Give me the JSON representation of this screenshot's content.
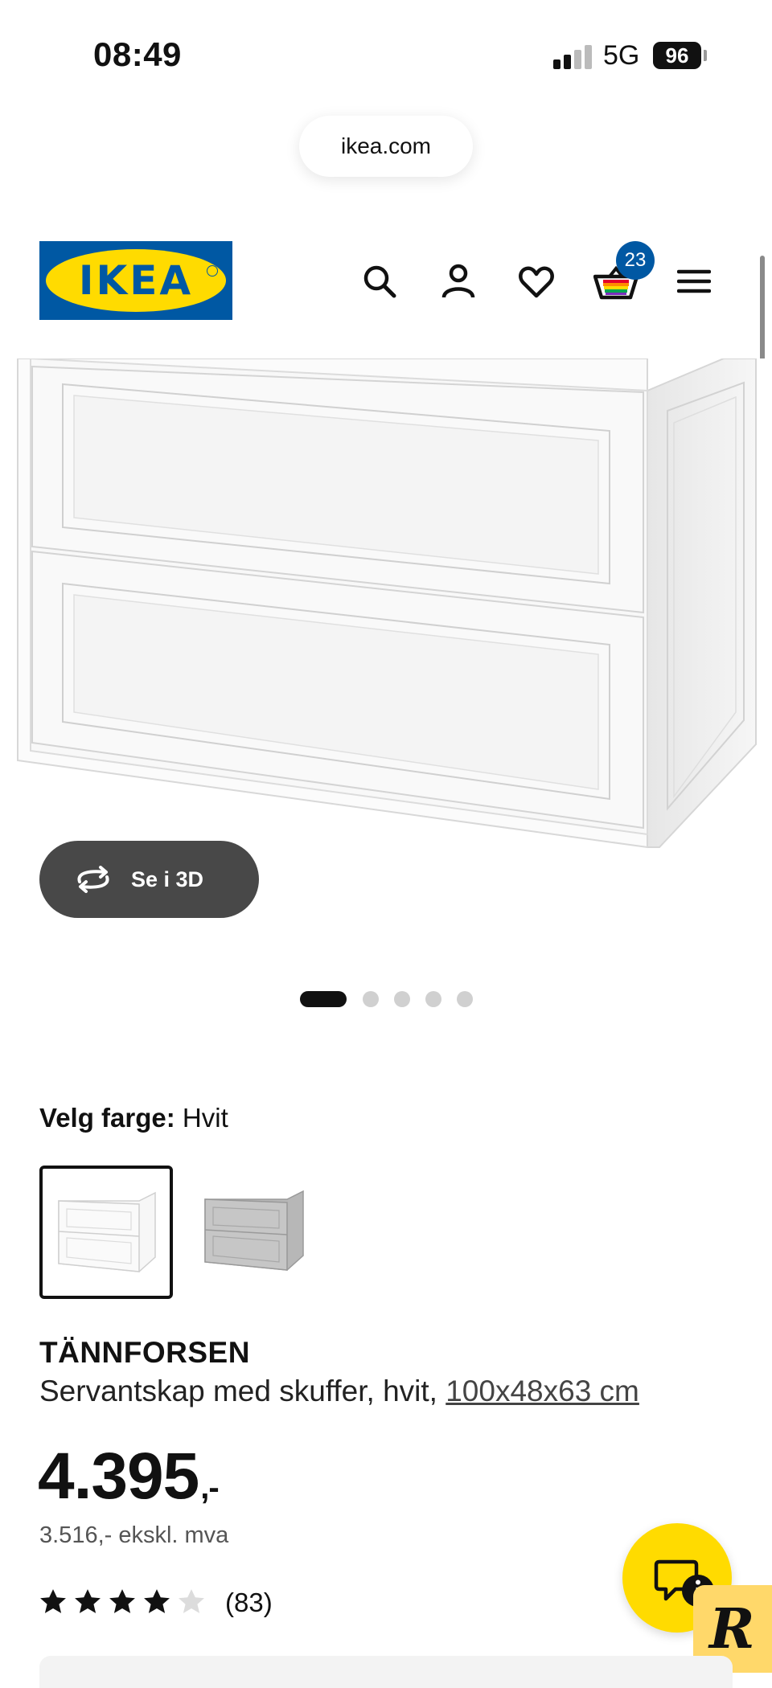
{
  "status_bar": {
    "time": "08:49",
    "network": "5G",
    "battery": "96"
  },
  "browser": {
    "url": "ikea.com"
  },
  "header": {
    "logo_text": "IKEA",
    "cart_count": "23",
    "icons": [
      "search-icon",
      "account-icon",
      "heart-icon",
      "cart-icon",
      "menu-icon"
    ]
  },
  "gallery": {
    "view_3d_label": "Se i 3D",
    "image_count": 5,
    "active_index": 0
  },
  "color_select": {
    "label": "Velg farge:",
    "value": "Hvit",
    "options": [
      "Hvit",
      "Grå"
    ]
  },
  "product": {
    "name": "TÄNNFORSEN",
    "description": "Servantskap med skuffer, hvit, ",
    "dimensions": "100x48x63 cm",
    "price": "4.395",
    "price_suffix": ",-",
    "price_ex_vat": "3.516,- ekskl. mva",
    "rating": 4,
    "rating_max": 5,
    "review_count": "(83)"
  },
  "colors": {
    "ikea_blue": "#0058a3",
    "ikea_yellow": "#ffdb00",
    "button_dark": "#484848"
  }
}
